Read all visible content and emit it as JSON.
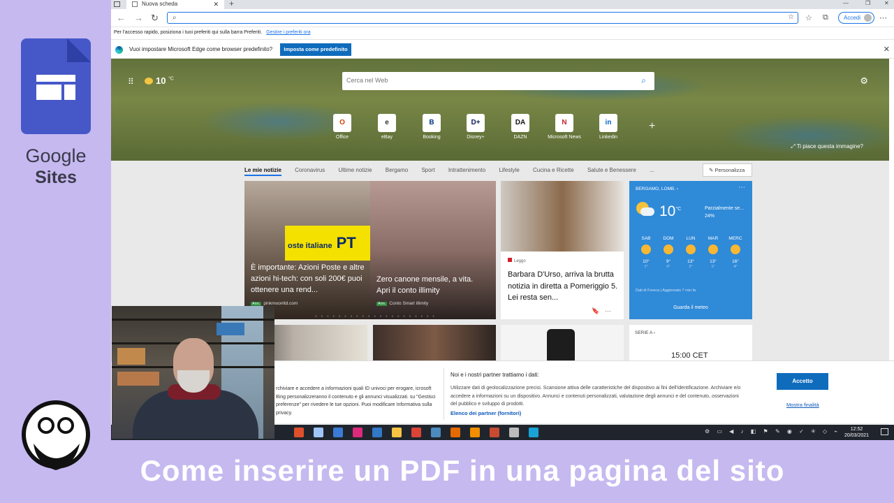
{
  "branding": {
    "logo_word1": "Google",
    "logo_word2": "Sites",
    "video_title": "Come inserire un PDF in una pagina del sito"
  },
  "browser": {
    "tab_title": "Nuova scheda",
    "address_value": "",
    "signin_label": "Accedi",
    "favorites_bar_text": "Per l'accesso rapido, posiziona i tuoi preferiti qui sulla barra Preferiti.",
    "favorites_manage_link": "Gestire i preferiti ora",
    "default_prompt": "Vuoi impostare Microsoft Edge come browser predefinito?",
    "default_button": "Imposta come predefinito"
  },
  "newtab": {
    "weather_temp": "10",
    "weather_unit": "°C",
    "search_placeholder": "Cerca nel Web",
    "quick_links": [
      {
        "label": "Office",
        "glyph": "O",
        "color": "#d83b01"
      },
      {
        "label": "eBay",
        "glyph": "e",
        "color": "#333333"
      },
      {
        "label": "Booking",
        "glyph": "B",
        "color": "#003580"
      },
      {
        "label": "Disney+",
        "glyph": "D+",
        "color": "#0b1b53"
      },
      {
        "label": "DAZN",
        "glyph": "DA",
        "color": "#111111"
      },
      {
        "label": "Microsoft News",
        "glyph": "N",
        "color": "#c4262e"
      },
      {
        "label": "Linkedin",
        "glyph": "in",
        "color": "#0a66c2"
      }
    ],
    "image_prompt": "Ti piace questa immagine?",
    "feed_tabs": [
      "Le mie notizie",
      "Coronavirus",
      "Ultime notizie",
      "Bergamo",
      "Sport",
      "Intrattenimento",
      "Lifestyle",
      "Cucina e Ricette",
      "Salute e Benessere",
      "..."
    ],
    "personalize_label": "Personalizza",
    "card1": {
      "pt_brand": "oste italiane",
      "pt_letters": "PT",
      "left_headline": "È importante: Azioni Poste e altre azioni hi-tech: con soli 200€ puoi ottenere una rend...",
      "left_tag": "Ann.",
      "left_source": "pinkmoonltd.com",
      "right_headline": "Zero canone mensile, a vita. Apri il conto illimity",
      "right_tag": "Ann.",
      "right_source": "Conto Smart illimity"
    },
    "card2": {
      "source": "Leggo",
      "headline": "Barbara D'Urso, arriva la brutta notizia in diretta a Pomeriggio 5. Lei resta sen..."
    },
    "weather_card": {
      "location": "BERGAMO, LOMB.",
      "temp": "10",
      "unit": "°C",
      "desc_line1": "Parzialmente se...",
      "desc_line2": "24%",
      "days": [
        {
          "name": "SAB",
          "hi": "10°",
          "lo": "1°"
        },
        {
          "name": "DOM",
          "hi": "9°",
          "lo": "0°"
        },
        {
          "name": "LUN",
          "hi": "13°",
          "lo": "2°"
        },
        {
          "name": "MAR",
          "hi": "13°",
          "lo": "1°"
        },
        {
          "name": "MERC",
          "hi": "16°",
          "lo": "4°"
        }
      ],
      "updated": "Dati di Foreca | Aggiornato 7 min fa",
      "see_more": "Guarda il meteo"
    },
    "sport_card": {
      "league": "SERIE A",
      "time": "15:00 CET"
    }
  },
  "cookie": {
    "left_text": "rchiviare e accedere a informazioni quali ID univoci per erogare, icrosoft Bing personalizzeranno il contenuto e gli annunci visualizzati. su \"Gestisci preferenze\" per rivedere le tue opzioni. Puoi modificare Informativa sulla privacy.",
    "title": "Noi e i nostri partner trattiamo i dati:",
    "body": "Utilizzare dati di geolocalizzazione precisi. Scansione attiva delle caratteristiche del dispositivo ai fini dell'identificazione. Archiviare e/o accedere a informazioni su un dispositivo. Annunci e contenuti personalizzati, valutazione degli annunci e del contenuto, osservazioni del pubblico e sviluppo di prodotti.",
    "partners_link": "Elenco dei partner (fornitori)",
    "accept_button": "Accetto",
    "purpose_link": "Mostra finalità"
  },
  "taskbar": {
    "time": "12:52",
    "date": "20/03/2021",
    "apps": [
      "#e04f2b",
      "#9fc5f8",
      "#3a7bd5",
      "#dd2a7b",
      "#3178c6",
      "#f6c343",
      "#db4437",
      "#4b8bbe",
      "#e66a00",
      "#f18f00",
      "#c84b31",
      "#bbbbbb",
      "#19a2d6"
    ]
  }
}
